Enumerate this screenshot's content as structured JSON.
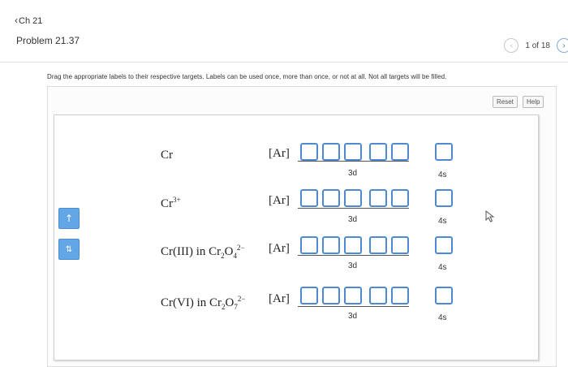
{
  "header": {
    "back_link": "Ch 21",
    "problem_title": "Problem 21.37",
    "pager_text": "1 of 18"
  },
  "instructions": "Drag the appropriate labels to their respective targets. Labels can be used once, more than once, or not at all. Not all targets will be filled.",
  "toolbar": {
    "reset_label": "Reset",
    "help_label": "Help"
  },
  "labels": [
    {
      "name": "single-up-arrow",
      "glyph": "↑"
    },
    {
      "name": "paired-arrows",
      "glyph": "⇅"
    }
  ],
  "rows": [
    {
      "species_html": "Cr",
      "core": "[Ar]",
      "d_label": "3d",
      "s_label": "4s"
    },
    {
      "species_html": "Cr<sup>3+</sup>",
      "core": "[Ar]",
      "d_label": "3d",
      "s_label": "4s"
    },
    {
      "species_html": "Cr(III) in Cr<sub>2</sub>O<sub>4</sub><sup>2−</sup>",
      "core": "[Ar]",
      "d_label": "3d",
      "s_label": "4s"
    },
    {
      "species_html": "Cr(VI) in Cr<sub>2</sub>O<sub>7</sub><sup>2−</sup>",
      "core": "[Ar]",
      "d_label": "3d",
      "s_label": "4s"
    }
  ],
  "colors": {
    "tile": "#63a6e6",
    "slot_border": "#4d8ad1",
    "accent": "#3b7fc4"
  }
}
